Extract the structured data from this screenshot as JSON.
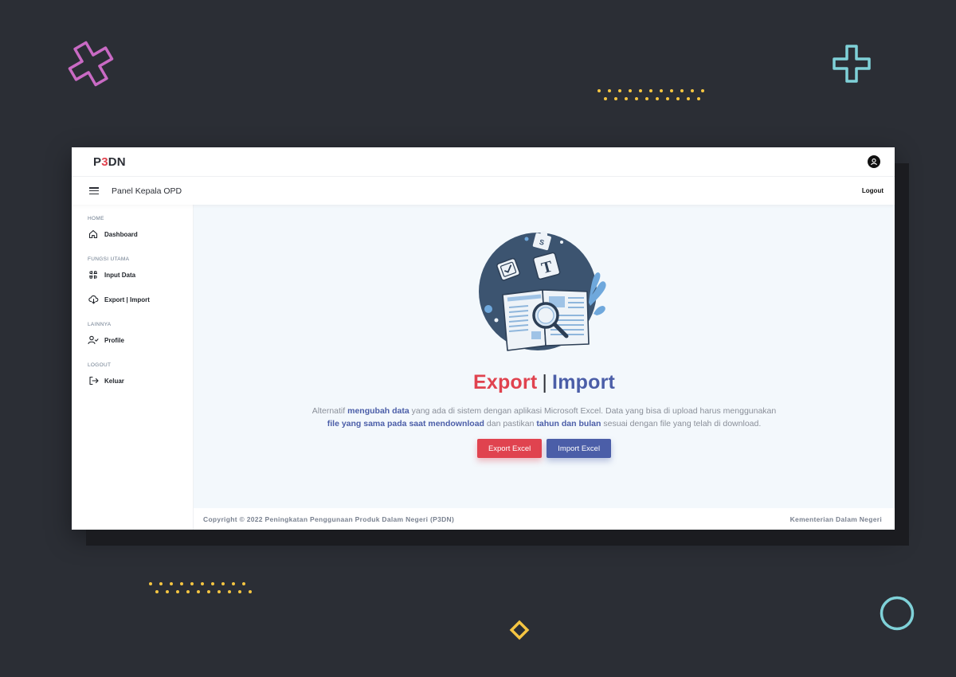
{
  "app": {
    "brand_prefix": "P",
    "brand_accent": "3",
    "brand_suffix": "DN",
    "panel_title": "Panel Kepala OPD",
    "logout_label": "Logout"
  },
  "sidebar": {
    "sections": [
      {
        "heading": "HOME",
        "items": [
          {
            "label": "Dashboard",
            "icon": "home-icon"
          }
        ]
      },
      {
        "heading": "FUNGSI UTAMA",
        "items": [
          {
            "label": "Input Data",
            "icon": "grid-hash-icon"
          },
          {
            "label": "Export | Import",
            "icon": "cloud-download-icon"
          }
        ]
      },
      {
        "heading": "LAINNYA",
        "items": [
          {
            "label": "Profile",
            "icon": "user-check-icon"
          }
        ]
      },
      {
        "heading": "LOGOUT",
        "items": [
          {
            "label": "Keluar",
            "icon": "sign-out-icon"
          }
        ]
      }
    ]
  },
  "main": {
    "headline_export": "Export",
    "headline_sep": "|",
    "headline_import": "Import",
    "desc": {
      "p1": "Alternatif ",
      "b1": "mengubah data",
      "p2": " yang ada di sistem dengan aplikasi Microsoft Excel. Data yang bisa di upload harus menggunakan ",
      "b2": "file yang sama pada saat mendownload",
      "p3": " dan pastikan ",
      "b3": "tahun dan bulan",
      "p4": " sesuai dengan file yang telah di download."
    },
    "export_button": "Export Excel",
    "import_button": "Import Excel"
  },
  "footer": {
    "copyright": "Copyright © 2022 Peningkatan Penggunaan Produk Dalam Negeri (P3DN)",
    "org": "Kementerian Dalam Negeri"
  },
  "colors": {
    "accent_red": "#e0434f",
    "accent_blue": "#4b5ea8",
    "background": "#2b2e35",
    "dots": "#f5c542"
  }
}
